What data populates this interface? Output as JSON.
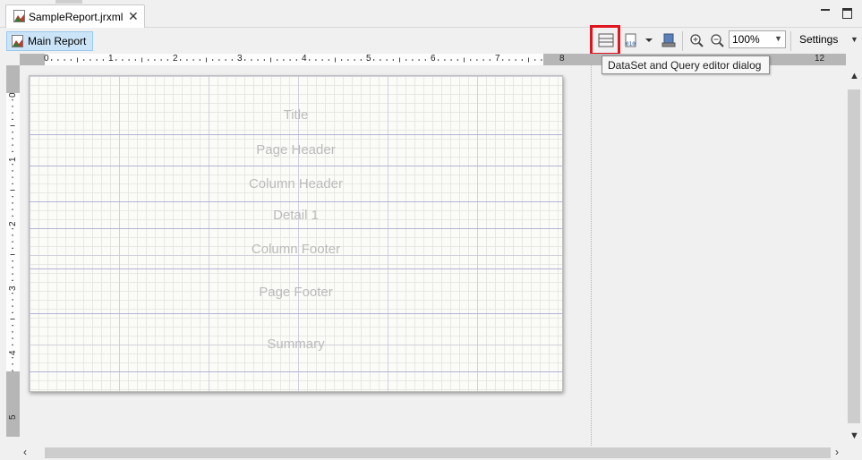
{
  "editor_tab": {
    "title": "SampleReport.jrxml",
    "close_glyph": "✕"
  },
  "toolbar": {
    "main_report_label": "Main Report",
    "zoom_value": "100%",
    "settings_label": "Settings",
    "dataset_tooltip": "DataSet and Query editor dialog",
    "icons": [
      "dataset-query-icon",
      "preview-data-icon",
      "dropdown-caret-icon",
      "compile-icon",
      "zoom-in-icon",
      "zoom-out-icon"
    ]
  },
  "ruler": {
    "horizontal_numbers": [
      "0",
      "1",
      "2",
      "3",
      "4",
      "5",
      "6",
      "7",
      "8",
      "12"
    ],
    "vertical_numbers": [
      "0",
      "1",
      "2",
      "3",
      "4",
      "5"
    ]
  },
  "bands": [
    "Title",
    "Page Header",
    "Column Header",
    "Detail 1",
    "Column Footer",
    "Page Footer",
    "Summary"
  ],
  "colors": {
    "highlight": "#e0141e",
    "selected_bg": "#cce4f7",
    "band_label": "#bbbbbb"
  }
}
